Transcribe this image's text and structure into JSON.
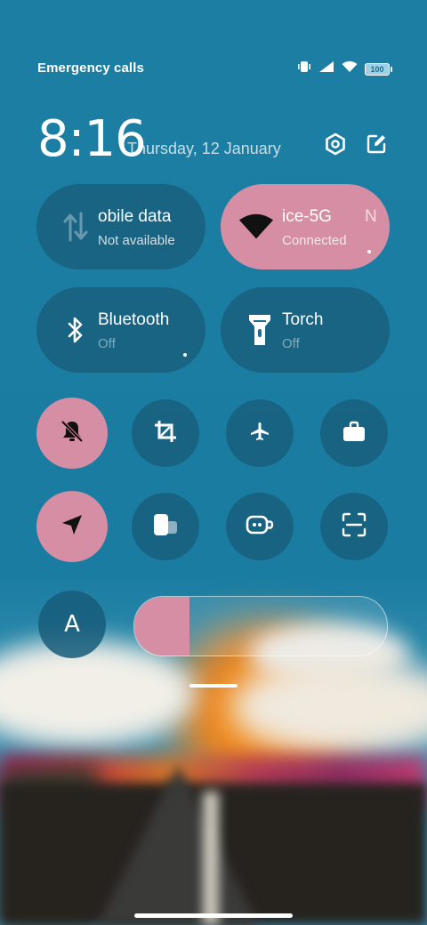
{
  "status_bar": {
    "emergency_text": "Emergency calls o",
    "battery_level": "100"
  },
  "header": {
    "time": "8:16",
    "date": "Thursday, 12 January"
  },
  "tiles": [
    {
      "title": "obile data",
      "subtitle": "Not available",
      "active": false,
      "icon": "mobile-data-icon"
    },
    {
      "title": "ice-5G",
      "title_suffix": "N",
      "subtitle": "Connected",
      "active": true,
      "icon": "wifi-icon"
    },
    {
      "title": "Bluetooth",
      "subtitle": "Off",
      "active": false,
      "icon": "bluetooth-icon"
    },
    {
      "title": "Torch",
      "subtitle": "Off",
      "active": false,
      "icon": "flashlight-icon"
    }
  ],
  "toggles_row1": [
    {
      "name": "silent-mode",
      "active": true,
      "icon": "bell-off-icon"
    },
    {
      "name": "screenshot",
      "active": false,
      "icon": "crop-icon"
    },
    {
      "name": "airplane-mode",
      "active": false,
      "icon": "airplane-icon"
    },
    {
      "name": "work-profile",
      "active": false,
      "icon": "briefcase-icon"
    }
  ],
  "toggles_row2": [
    {
      "name": "location",
      "active": true,
      "icon": "location-arrow-icon"
    },
    {
      "name": "dual-apps",
      "active": false,
      "icon": "dual-screen-icon"
    },
    {
      "name": "video-toolbox",
      "active": false,
      "icon": "camera-icon"
    },
    {
      "name": "scanner",
      "active": false,
      "icon": "scan-icon"
    }
  ],
  "brightness": {
    "auto_label": "A",
    "level": 0.22
  },
  "colors": {
    "accent": "#d58ea4",
    "background": "#1b7ba0"
  }
}
